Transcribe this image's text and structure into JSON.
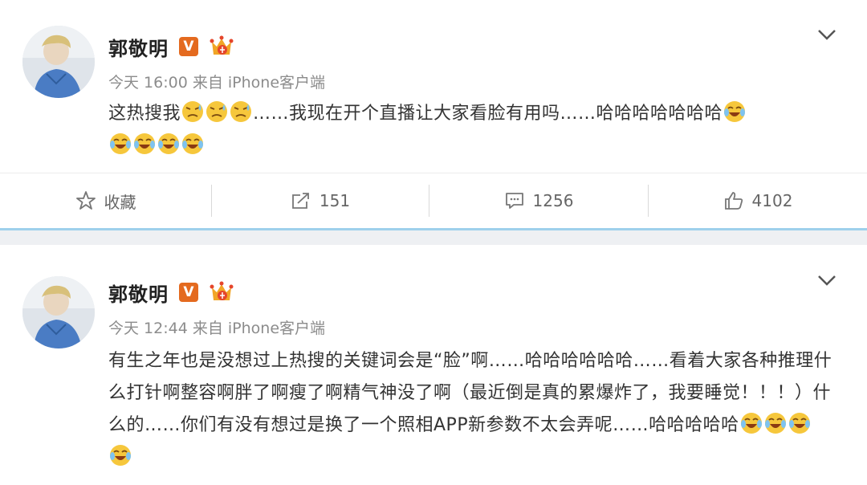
{
  "posts": [
    {
      "username": "郭敬明",
      "verified_badge": "V",
      "time": "今天 16:00",
      "source": "来自 iPhone客户端",
      "text_before": "这热搜我",
      "text_middle": "……我现在开个直播让大家看脸有用吗……哈哈哈哈哈哈哈",
      "emoji_inline_1": "sweat-face-emoji",
      "emoji_laugh": "laugh-cry-emoji",
      "actions": {
        "favorite_label": "收藏",
        "repost_count": "151",
        "comment_count": "1256",
        "like_count": "4102"
      }
    },
    {
      "username": "郭敬明",
      "verified_badge": "V",
      "time": "今天 12:44",
      "source": "来自 iPhone客户端",
      "text": "有生之年也是没想过上热搜的关键词会是“脸”啊……哈哈哈哈哈哈……看着大家各种推理什么打针啊整容啊胖了啊瘦了啊精气神没了啊（最近倒是真的累爆炸了，我要睡觉！！！）什么的……你们有没有想过是换了一个照相APP新参数不太会弄呢……哈哈哈哈哈",
      "emoji_laugh": "laugh-cry-emoji"
    }
  ],
  "colors": {
    "accent_badge": "#e46a1f",
    "divider_blue": "#9ed0ec",
    "meta_gray": "#8c8c8c"
  }
}
